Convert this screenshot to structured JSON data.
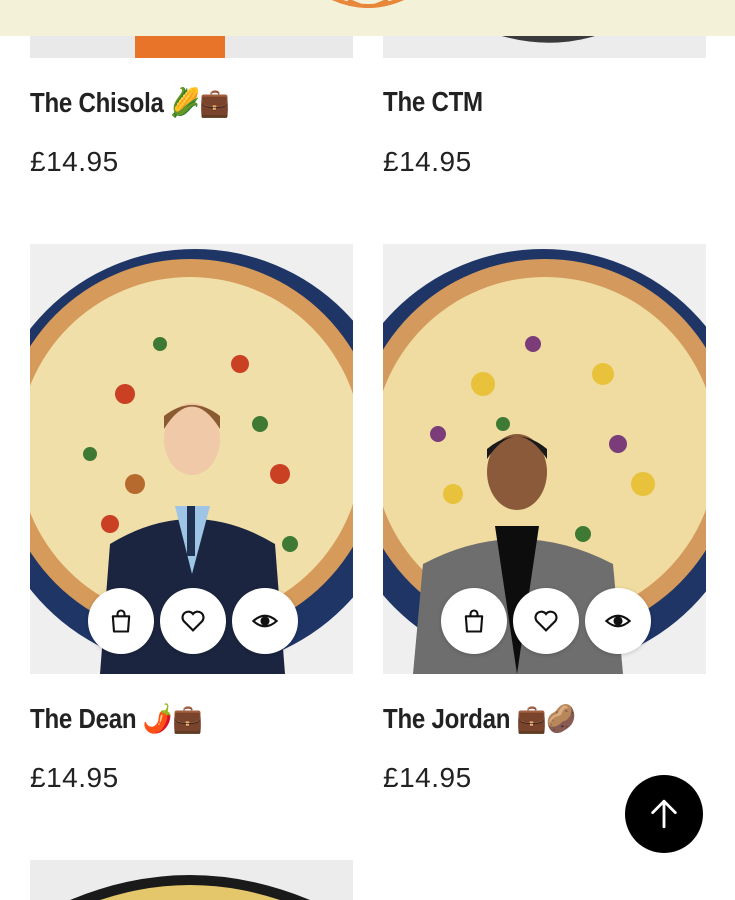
{
  "products": [
    {
      "name": "The Chisola",
      "emoji": "🌽💼",
      "price": "£14.95"
    },
    {
      "name": "The CTM",
      "emoji": "",
      "price": "£14.95"
    },
    {
      "name": "The Dean",
      "emoji": "🌶️💼",
      "price": "£14.95"
    },
    {
      "name": "The Jordan",
      "emoji": "💼🥔",
      "price": "£14.95"
    }
  ],
  "actions": {
    "add_to_cart_icon": "shopping-bag-icon",
    "wishlist_icon": "heart-icon",
    "quick_view_icon": "eye-icon"
  },
  "scroll_top": {
    "icon": "arrow-up-icon"
  },
  "colors": {
    "topbar": "#f4f1d9",
    "accent": "#e8873a",
    "button_dark": "#000000",
    "plate": "#1e3566"
  }
}
